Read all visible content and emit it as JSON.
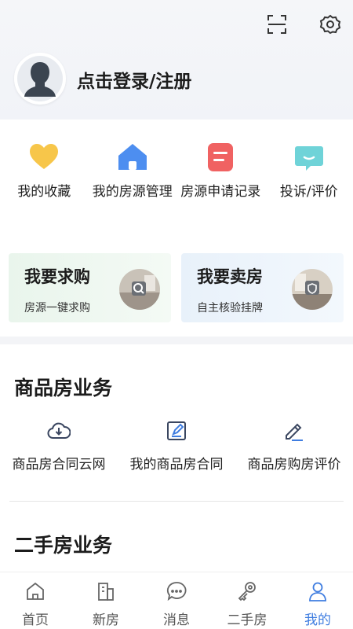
{
  "header": {
    "login_text": "点击登录/注册"
  },
  "quick_actions": [
    {
      "label": "我的收藏",
      "icon": "heart-icon"
    },
    {
      "label": "我的房源管理",
      "icon": "house-icon"
    },
    {
      "label": "房源申请记录",
      "icon": "document-icon"
    },
    {
      "label": "投诉/评价",
      "icon": "chat-bubble-icon"
    }
  ],
  "cards": {
    "buy": {
      "title": "我要求购",
      "subtitle": "房源一键求购"
    },
    "sell": {
      "title": "我要卖房",
      "subtitle": "自主核验挂牌"
    }
  },
  "section_new": {
    "title": "商品房业务",
    "items": [
      {
        "label": "商品房合同云网",
        "icon": "cloud-download-icon"
      },
      {
        "label": "我的商品房合同",
        "icon": "edit-document-icon"
      },
      {
        "label": "商品房购房评价",
        "icon": "pen-icon"
      }
    ]
  },
  "section_second": {
    "title": "二手房业务"
  },
  "tabbar": [
    {
      "label": "首页",
      "icon": "home-icon"
    },
    {
      "label": "新房",
      "icon": "building-icon"
    },
    {
      "label": "消息",
      "icon": "message-icon"
    },
    {
      "label": "二手房",
      "icon": "key-icon"
    },
    {
      "label": "我的",
      "icon": "person-icon",
      "active": true
    }
  ],
  "colors": {
    "accent": "#3f7de0",
    "heart": "#f7c64a",
    "house": "#4d8ef0",
    "doc": "#f06262",
    "chat": "#6fd3d8"
  }
}
